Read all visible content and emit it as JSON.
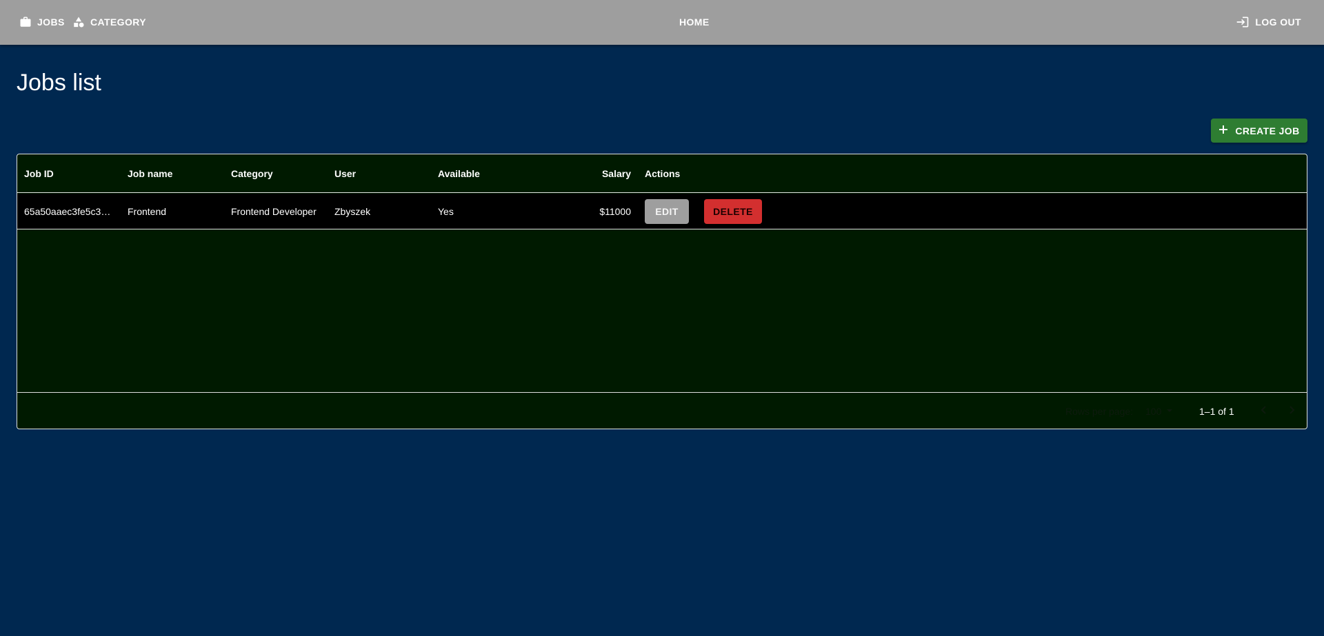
{
  "nav": {
    "jobs_label": "JOBS",
    "category_label": "CATEGORY",
    "home_label": "HOME",
    "logout_label": "LOG OUT",
    "icons": {
      "jobs": "briefcase-icon",
      "category": "category-shapes-icon",
      "logout": "login-arrow-icon"
    }
  },
  "page": {
    "title": "Jobs list",
    "create_button_label": "CREATE JOB",
    "create_button_icon": "plus-icon"
  },
  "grid": {
    "columns": [
      "Job ID",
      "Job name",
      "Category",
      "User",
      "Available",
      "Salary",
      "Actions"
    ],
    "rows": [
      {
        "id": "65a50aaec3fe5c3…",
        "name": "Frontend",
        "category": "Frontend Developer",
        "user": "Zbyszek",
        "available": "Yes",
        "salary": "$11000",
        "edit_label": "EDIT",
        "delete_label": "DELETE"
      }
    ],
    "footer": {
      "rows_per_page_label": "Rows per page:",
      "rows_per_page_value": "100",
      "page_range": "1–1 of 1"
    }
  },
  "colors": {
    "background": "#002850",
    "appbar": "#9e9e9e",
    "grid_background": "#001a00",
    "row_background": "#000000",
    "create_button": "#2e7d32",
    "edit_button": "#9e9e9e",
    "delete_button": "#d32f2f"
  }
}
